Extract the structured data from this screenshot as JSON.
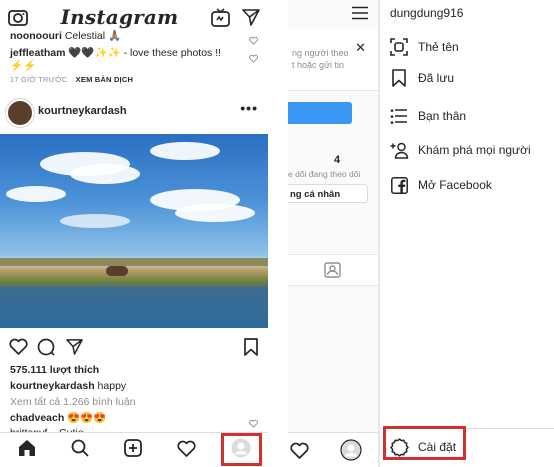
{
  "feed": {
    "logo": "Instagram",
    "comment1": {
      "user": "noonoouri",
      "text": "Celestial 🙏🏽"
    },
    "comment2": {
      "user": "jeffleatham",
      "text": "🖤🖤✨✨ - love these photos !! ⚡⚡"
    },
    "timestamp": "17 GIỜ TRƯỚC",
    "translate": "XEM BẢN DỊCH",
    "post": {
      "username": "kourtneykardash",
      "more": "•••",
      "likes": "575.111 lượt thích",
      "caption_user": "kourtneykardash",
      "caption_text": "happy",
      "view_comments": "Xem tất cả 1.266 bình luận",
      "comment_user": "chadveach",
      "comment_text": "😍😍😍",
      "clipped_comment": "brittanyf... Cutie"
    }
  },
  "profile_mid": {
    "card_line1": "ng người theo",
    "card_line2": "t hoặc gửi tin",
    "close": "✕",
    "stat_number": "4",
    "stat_label": "e dõi  đang theo dõi",
    "edit_button": "ng cá nhân"
  },
  "drawer": {
    "username": "dungdung916",
    "items": [
      {
        "label": "Thẻ tên",
        "icon": "nametag-icon"
      },
      {
        "label": "Đã lưu",
        "icon": "bookmark-icon"
      },
      {
        "label": "Bạn thân",
        "icon": "close-friends-icon"
      },
      {
        "label": "Khám phá mọi người",
        "icon": "add-person-icon"
      },
      {
        "label": "Mở Facebook",
        "icon": "facebook-icon"
      }
    ],
    "settings": "Cài đặt"
  },
  "colors": {
    "highlight": "#d32f2f",
    "primary_blue": "#3897f0",
    "text": "#262626",
    "secondary": "#8e8e8e"
  }
}
